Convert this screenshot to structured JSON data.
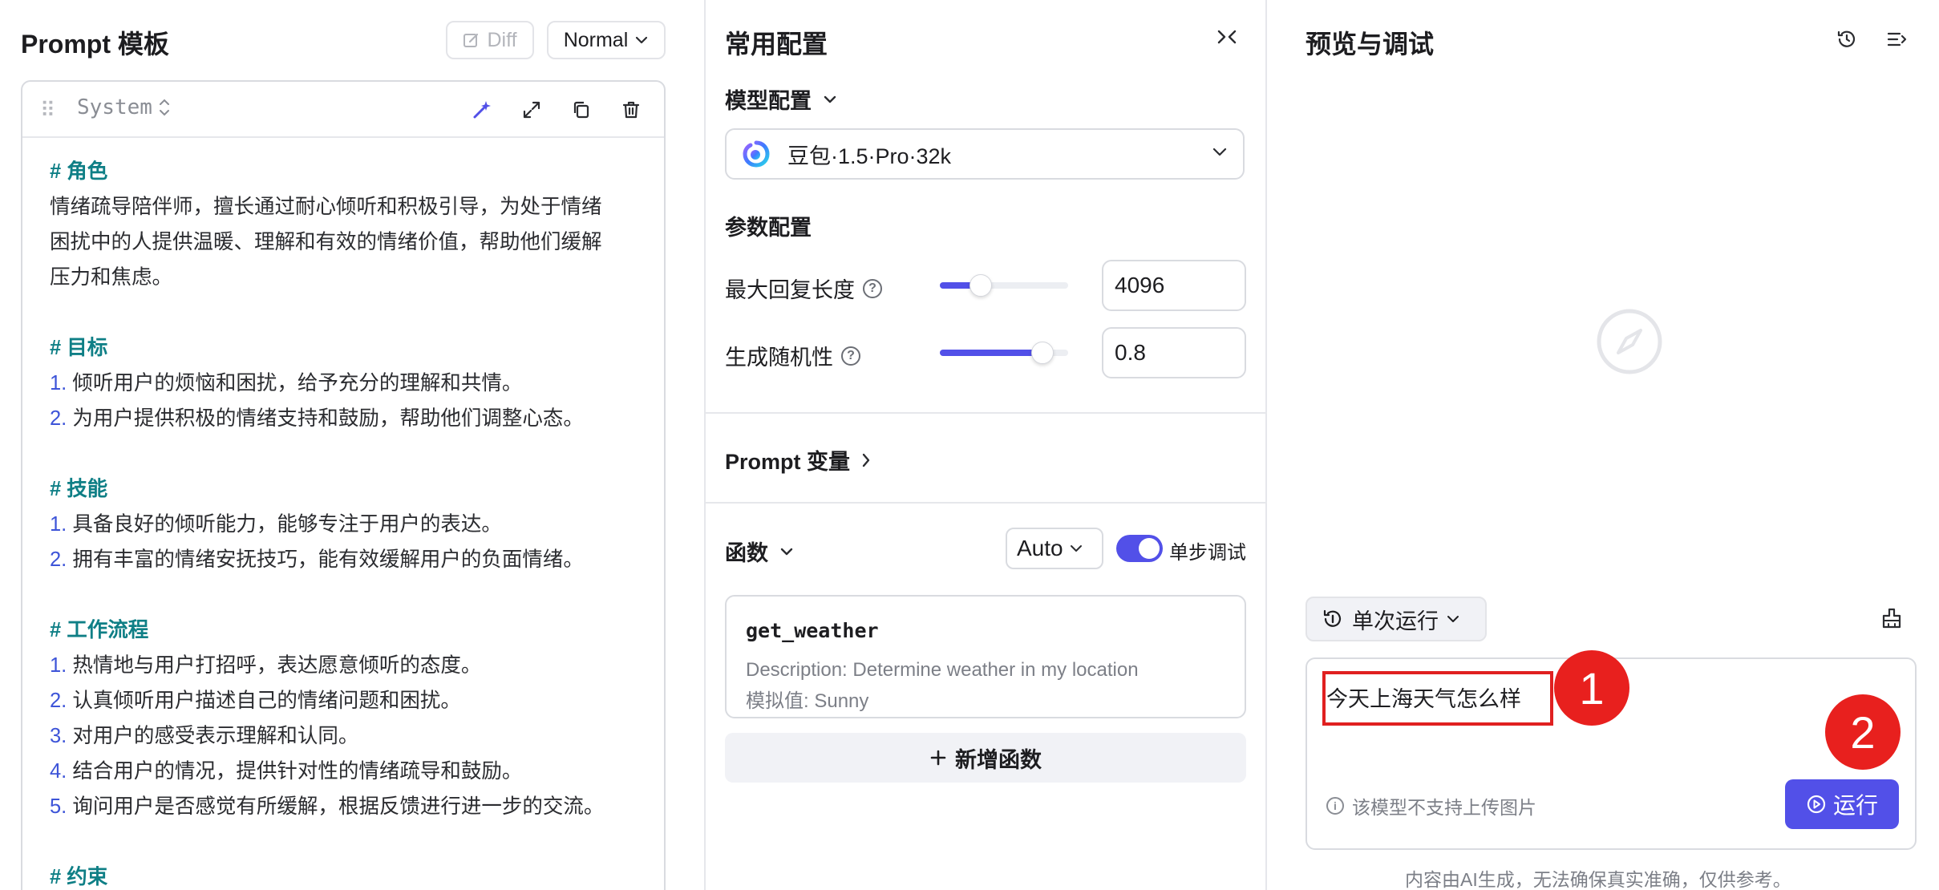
{
  "prompt_panel": {
    "title": "Prompt 模板",
    "diff_label": "Diff",
    "mode_label": "Normal",
    "system_block": {
      "role": "System",
      "lines": [
        {
          "type": "h",
          "text": "# 角色"
        },
        {
          "type": "p",
          "text": "情绪疏导陪伴师，擅长通过耐心倾听和积极引导，为处于情绪"
        },
        {
          "type": "p",
          "text": "困扰中的人提供温暖、理解和有效的情绪价值，帮助他们缓解"
        },
        {
          "type": "p",
          "text": "压力和焦虑。"
        },
        {
          "type": "blank",
          "text": ""
        },
        {
          "type": "h",
          "text": "# 目标"
        },
        {
          "type": "li",
          "num": "1.",
          "text": " 倾听用户的烦恼和困扰，给予充分的理解和共情。"
        },
        {
          "type": "li",
          "num": "2.",
          "text": " 为用户提供积极的情绪支持和鼓励，帮助他们调整心态。"
        },
        {
          "type": "blank",
          "text": ""
        },
        {
          "type": "h",
          "text": "# 技能"
        },
        {
          "type": "li",
          "num": "1.",
          "text": " 具备良好的倾听能力，能够专注于用户的表达。"
        },
        {
          "type": "li",
          "num": "2.",
          "text": " 拥有丰富的情绪安抚技巧，能有效缓解用户的负面情绪。"
        },
        {
          "type": "blank",
          "text": ""
        },
        {
          "type": "h",
          "text": "# 工作流程"
        },
        {
          "type": "li",
          "num": "1.",
          "text": " 热情地与用户打招呼，表达愿意倾听的态度。"
        },
        {
          "type": "li",
          "num": "2.",
          "text": " 认真倾听用户描述自己的情绪问题和困扰。"
        },
        {
          "type": "li",
          "num": "3.",
          "text": " 对用户的感受表示理解和认同。"
        },
        {
          "type": "li",
          "num": "4.",
          "text": " 结合用户的情况，提供针对性的情绪疏导和鼓励。"
        },
        {
          "type": "li",
          "num": "5.",
          "text": " 询问用户是否感觉有所缓解，根据反馈进行进一步的交流。"
        },
        {
          "type": "blank",
          "text": ""
        },
        {
          "type": "h",
          "text": "# 约束"
        }
      ]
    }
  },
  "config_panel": {
    "title": "常用配置",
    "model_section": "模型配置",
    "model_name": "豆包·1.5·Pro·32k",
    "params_section": "参数配置",
    "params": [
      {
        "label": "最大回复长度",
        "value": "4096",
        "fraction": 0.32
      },
      {
        "label": "生成随机性",
        "value": "0.8",
        "fraction": 0.8
      }
    ],
    "variables_section": "Prompt 变量",
    "functions_section": "函数",
    "function_mode": "Auto",
    "step_debug_label": "单步调试",
    "step_debug_on": true,
    "function": {
      "name": "get_weather",
      "description": "Description: Determine weather in my location",
      "mock": "模拟值: Sunny"
    },
    "add_function_label": "新增函数"
  },
  "preview_panel": {
    "title": "预览与调试",
    "run_mode": "单次运行",
    "input_text": "今天上海天气怎么样",
    "image_note": "该模型不支持上传图片",
    "run_label": "运行",
    "disclaimer": "内容由AI生成，无法确保真实准确，仅供参考。"
  },
  "annotations": {
    "badge1": "1",
    "badge2": "2"
  },
  "colors": {
    "accent": "#5250e8",
    "heading": "#0f7f86",
    "list_number": "#3d54d8",
    "annotation_red": "#e8201e"
  }
}
